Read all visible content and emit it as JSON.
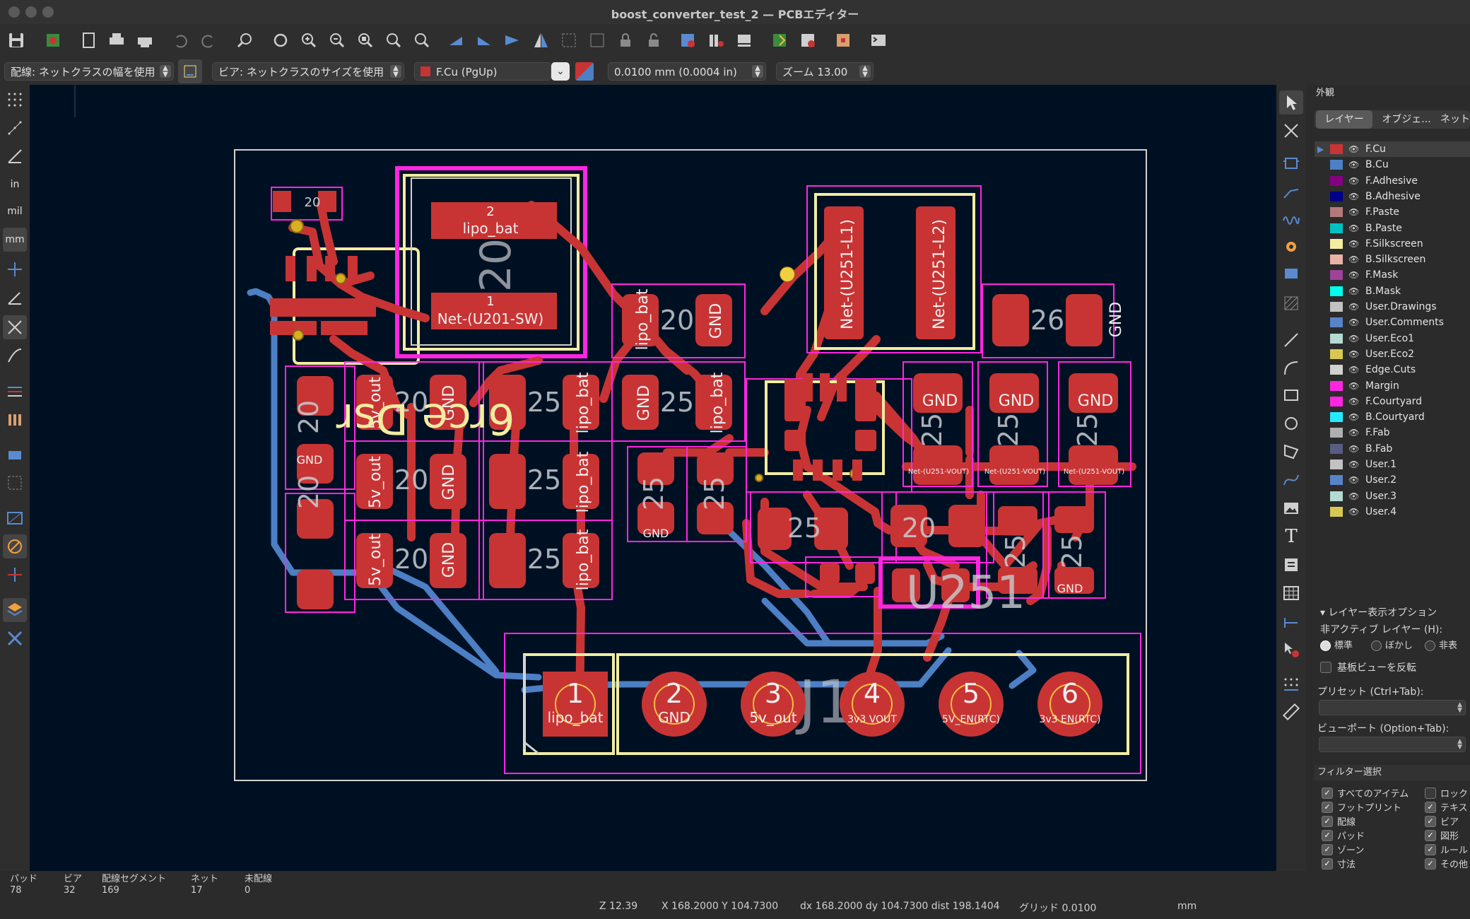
{
  "window": {
    "title": "boost_converter_test_2 — PCBエディター"
  },
  "options": {
    "track_width": "配線: ネットクラスの幅を使用",
    "via_size": "ビア: ネットクラスのサイズを使用",
    "layer": "F.Cu (PgUp)",
    "grid": "0.0100 mm (0.0004 in)",
    "zoom": "ズーム 13.00"
  },
  "left_tools": {
    "inch_label": "in",
    "mil_label": "mil",
    "mm_label": "mm"
  },
  "panel": {
    "title": "外観",
    "tabs": [
      "レイヤー",
      "オブジェ...",
      "ネット"
    ],
    "layers": [
      {
        "name": "F.Cu",
        "color": "#c83434"
      },
      {
        "name": "B.Cu",
        "color": "#4d7fc4"
      },
      {
        "name": "F.Adhesive",
        "color": "#84007f"
      },
      {
        "name": "B.Adhesive",
        "color": "#00008a"
      },
      {
        "name": "F.Paste",
        "color": "#b47a7a"
      },
      {
        "name": "B.Paste",
        "color": "#00c2c2"
      },
      {
        "name": "F.Silkscreen",
        "color": "#f2eda1"
      },
      {
        "name": "B.Silkscreen",
        "color": "#e8b2a7"
      },
      {
        "name": "F.Mask",
        "color": "#a0429a"
      },
      {
        "name": "B.Mask",
        "color": "#02ffee"
      },
      {
        "name": "User.Drawings",
        "color": "#c2c2c2"
      },
      {
        "name": "User.Comments",
        "color": "#5983c8"
      },
      {
        "name": "User.Eco1",
        "color": "#b4dbd2"
      },
      {
        "name": "User.Eco2",
        "color": "#d8c852"
      },
      {
        "name": "Edge.Cuts",
        "color": "#d0d2cd"
      },
      {
        "name": "Margin",
        "color": "#ff26e2"
      },
      {
        "name": "F.Courtyard",
        "color": "#ff26e2"
      },
      {
        "name": "B.Courtyard",
        "color": "#26e9ff"
      },
      {
        "name": "F.Fab",
        "color": "#afafaf"
      },
      {
        "name": "B.Fab",
        "color": "#585d84"
      },
      {
        "name": "User.1",
        "color": "#c2c2c2"
      },
      {
        "name": "User.2",
        "color": "#5983c8"
      },
      {
        "name": "User.3",
        "color": "#b4dbd2"
      },
      {
        "name": "User.4",
        "color": "#d8c852"
      }
    ],
    "display_options": {
      "header": "レイヤー表示オプション",
      "inactive_label": "非アクティブ レイヤー (H):",
      "radio_normal": "標準",
      "radio_dim": "ぼかし",
      "radio_hide": "非表",
      "flip_board": "基板ビューを反転",
      "preset_label": "プリセット (Ctrl+Tab):",
      "viewport_label": "ビューポート (Option+Tab):"
    },
    "filter": {
      "header": "フィルター選択",
      "left": [
        "すべてのアイテム",
        "フットプリント",
        "配線",
        "パッド",
        "ゾーン",
        "寸法"
      ],
      "right": [
        "ロック",
        "テキス",
        "ビア",
        "図形",
        "ルール",
        "その他"
      ]
    }
  },
  "status": {
    "pads_label": "パッド",
    "pads": "78",
    "vias_label": "ビア",
    "vias": "32",
    "segments_label": "配線セグメント",
    "segments": "169",
    "nets_label": "ネット",
    "nets": "17",
    "unrouted_label": "未配線",
    "unrouted": "0",
    "z": "Z 12.39",
    "xy": "X 168.2000  Y 104.7300",
    "dxy": "dx 168.2000  dy 104.7300  dist 198.1404",
    "grid": "グリッド 0.0100",
    "units": "mm"
  },
  "board": {
    "connector_pins": [
      {
        "num": "1",
        "net": "lipo_bat"
      },
      {
        "num": "2",
        "net": "GND"
      },
      {
        "num": "3",
        "net": "5v_out"
      },
      {
        "num": "4",
        "net": "3v3 VOUT"
      },
      {
        "num": "5",
        "net": "5V_EN(RTC)"
      },
      {
        "num": "6",
        "net": "3v3 EN(RTC)"
      }
    ],
    "ref_j1": "J1",
    "ref_u251": "U251",
    "ref_l251": "Net-(U251-L1)",
    "ref_l251b": "Net-(U251-L2)",
    "inductor_top_net": "lipo_bat",
    "inductor_bot_net": "Net-(U201-SW)",
    "inductor_ref": "20",
    "mirrored_text": "6rce Dsr",
    "label_gnd": "GND",
    "label_5vout": "5v_out",
    "label_lipo": "lipo_bat",
    "label_20": "20",
    "label_25": "25",
    "label_26": "26",
    "label_vout": "Net-(U251-VOUT)",
    "pad_1": "1",
    "pad_2": "2"
  }
}
